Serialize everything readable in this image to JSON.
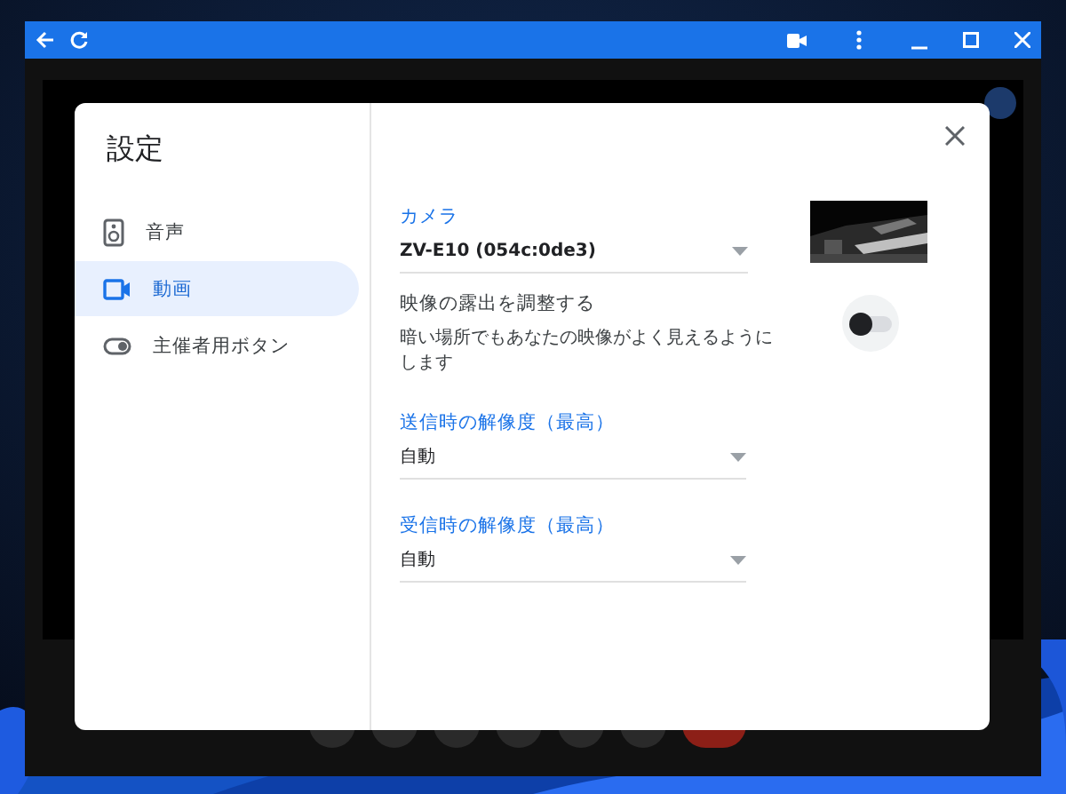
{
  "settings_dialog": {
    "title": "設定",
    "nav_items": [
      {
        "label": "音声",
        "kind": "speaker",
        "selected": false
      },
      {
        "label": "動画",
        "kind": "camera",
        "selected": true
      },
      {
        "label": "主催者用ボタン",
        "kind": "toggle",
        "selected": false
      }
    ],
    "camera": {
      "label": "カメラ",
      "value": "ZV-E10 (054c:0de3)"
    },
    "exposure": {
      "title": "映像の露出を調整する",
      "description": "暗い場所でもあなたの映像がよく見えるようにします",
      "on": false
    },
    "send_resolution": {
      "label": "送信時の解像度（最高）",
      "value": "自動"
    },
    "receive_resolution": {
      "label": "受信時の解像度（最高）",
      "value": "自動"
    }
  }
}
